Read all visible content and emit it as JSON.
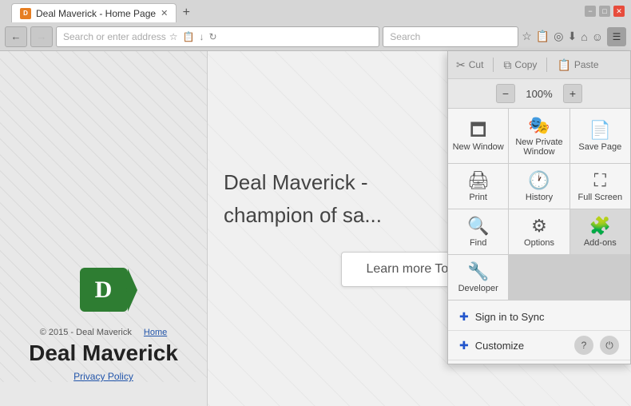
{
  "browser": {
    "title": "Deal Maverick - Home Page",
    "tab_label": "Deal Maverick - Home Page",
    "address_placeholder": "Search or enter address",
    "search_placeholder": "Search"
  },
  "webpage": {
    "logo_letter": "D",
    "copyright": "© 2015 - Deal Maverick",
    "home_link": "Home",
    "site_title": "Deal Maverick",
    "privacy_link": "Privacy Policy",
    "headline": "Deal Maverick -",
    "subheadline": "champion of sa...",
    "cta_button": "Learn more Today!"
  },
  "menu": {
    "cut_label": "Cut",
    "copy_label": "Copy",
    "paste_label": "Paste",
    "zoom_minus": "−",
    "zoom_level": "100%",
    "zoom_plus": "+",
    "new_window_label": "New Window",
    "new_private_label": "New Private Window",
    "save_page_label": "Save Page",
    "print_label": "Print",
    "history_label": "History",
    "full_screen_label": "Full Screen",
    "find_label": "Find",
    "options_label": "Options",
    "addons_label": "Add-ons",
    "developer_label": "Developer",
    "sign_in_label": "Sign in to Sync",
    "customize_label": "Customize"
  },
  "window_controls": {
    "minimize": "−",
    "maximize": "□",
    "close": "✕"
  }
}
